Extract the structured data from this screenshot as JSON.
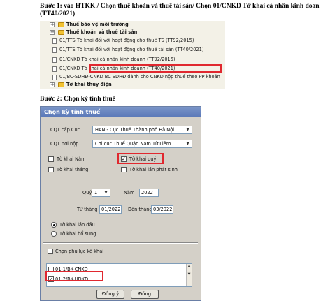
{
  "steps": {
    "step1": "Bước 1: vào HTKK / Chọn thuế khoản và thuế tài sản/ Chọn 01/CNKD Tờ khai cá nhân kinh doan (TT40/2021)",
    "step2": "Bước 2: Chọn kỳ tính thuế"
  },
  "tree": {
    "items": [
      {
        "label": "Thuế bảo vệ môi trường",
        "bold": true
      },
      {
        "label": "Thuế khoản và thuế tài sản",
        "bold": true
      },
      {
        "label": "01/TTS Tờ khai đối với hoạt động cho thuê TS (TT92/2015)",
        "bold": false
      },
      {
        "label": "01/TTS Tờ khai đối với hoạt động cho thuê tài sản (TT40/2021)",
        "bold": false
      },
      {
        "label": "01/CNKD Tờ khai cá nhân kinh doanh (TT92/2015)",
        "bold": false
      },
      {
        "label": "01/CNKD Tờ khai cá nhân kinh doanh (TT40/2021)",
        "bold": false
      },
      {
        "label": "01/BC-SDHĐ-CNKD BC SDHĐ dành cho CNKD nộp thuế theo PP khoán",
        "bold": false
      },
      {
        "label": "Tờ khai thủy điện",
        "bold": true
      }
    ]
  },
  "dialog": {
    "title": "Chọn kỳ tính thuế",
    "cqt_cap_cuc_label": "CQT cấp Cục",
    "cqt_cap_cuc_value": "HAN - Cục Thuế Thành phố Hà Nội",
    "cqt_noi_nop_label": "CQT nơi nộp",
    "cqt_noi_nop_value": "Chi cục Thuế Quận Nam Từ Liêm",
    "to_khai_nam": "Tờ khai Năm",
    "to_khai_quy": "Tờ khai quý",
    "to_khai_thang": "Tờ khai tháng",
    "to_khai_lan_phat_sinh": "Tờ khai lần phát sinh",
    "quy_label": "Quý",
    "quy_value": "1",
    "nam_label": "Năm",
    "nam_value": "2022",
    "tu_thang_label": "Từ tháng",
    "tu_thang_value": "01/2022",
    "den_thang_label": "Đến tháng",
    "den_thang_value": "03/2022",
    "to_khai_lan_dau": "Tờ khai lần đầu",
    "to_khai_bo_sung": "Tờ khai bổ sung",
    "chon_phu_luc": "Chọn phụ lục kê khai",
    "phu_luc": [
      {
        "label": "01-1/BK-CNKD",
        "checked": false
      },
      {
        "label": "01-2/BK-HĐKD",
        "checked": true
      }
    ],
    "dong_y": "Đồng ý",
    "dong": "Đóng"
  },
  "colors": {
    "highlight": "#e0282f",
    "title_bar": "#5a78b8",
    "dialog_bg": "#d4d0c8",
    "tree_bg": "#f3f1e7"
  }
}
